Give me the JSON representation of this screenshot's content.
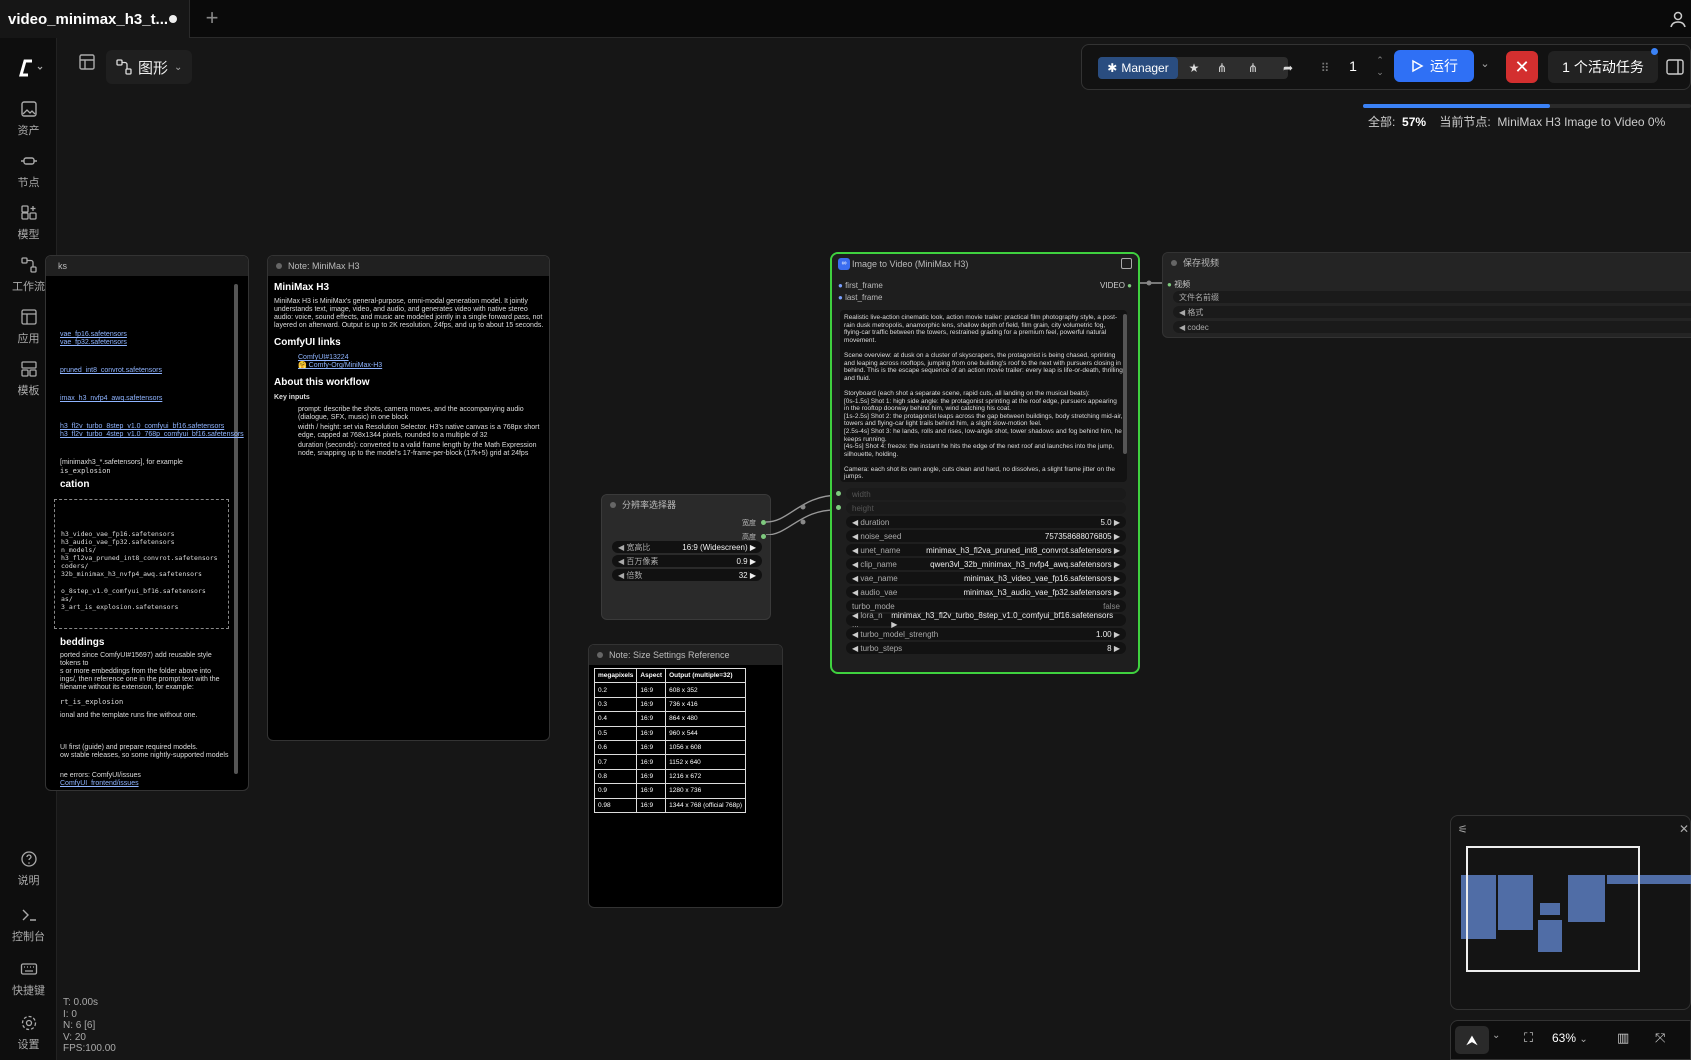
{
  "tab": {
    "title": "video_minimax_h3_t...",
    "plus": "+"
  },
  "toolbar": {
    "graph_label": "图形",
    "manager": "Manager",
    "queue_count": "1",
    "run_label": "运行",
    "cancel": "✕",
    "active_tasks": "1 个活动任务"
  },
  "progress": {
    "total_label": "全部:",
    "total_pct": "57%",
    "current_label": "当前节点:",
    "current_value": "MiniMax H3 Image to Video 0%",
    "fraction": 0.57
  },
  "sidebar": {
    "items": [
      {
        "label": "资产",
        "icon": "image-icon"
      },
      {
        "label": "节点",
        "icon": "node-icon"
      },
      {
        "label": "模型",
        "icon": "model-icon"
      },
      {
        "label": "工作流",
        "icon": "workflow-icon"
      },
      {
        "label": "应用",
        "icon": "app-icon"
      },
      {
        "label": "模板",
        "icon": "template-icon"
      }
    ],
    "bottom": [
      {
        "label": "说明",
        "icon": "help-icon"
      },
      {
        "label": "控制台",
        "icon": "terminal-icon"
      },
      {
        "label": "快捷键",
        "icon": "keyboard-icon"
      },
      {
        "label": "设置",
        "icon": "settings-icon"
      }
    ]
  },
  "left_note": {
    "title_fragment": "ks",
    "links": [
      "vae_fp16.safetensors",
      "vae_fp32.safetensors",
      "pruned_int8_convrot.safetensors",
      "imax_h3_nvfp4_awq.safetensors",
      "h3_fl2v_turbo_8step_v1.0_comfyui_bf16.safetensors",
      "h3_fl2v_turbo_4step_v1.0_768p_comfyui_bf16.safetensors"
    ],
    "example_note": "[minimaxh3_*.safetensors], for example",
    "example_value": "is_explosion",
    "heading_location": "cation",
    "files": [
      "h3_video_vae_fp16.safetensors",
      "h3_audio_vae_fp32.safetensors",
      "n_models/",
      "h3_fl2va_pruned_int8_convrot.safetensors",
      "coders/",
      "32b_minimax_h3_nvfp4_awq.safetensors",
      "o_8step_v1.0_comfyui_bf16.safetensors",
      "as/",
      "3_art_is_explosion.safetensors"
    ],
    "heading_embeddings": "beddings",
    "emb_text": [
      "ported since ComfyUI#15697) add reusable style tokens to",
      "s or more embeddings from the folder above into",
      "ings/, then reference one in the prompt text with the",
      "filename without its extension, for example:",
      "rt_is_explosion",
      "ional and the template runs fine without one."
    ],
    "footer": [
      "UI first (guide) and prepare required models.",
      "ow stable releases, so some nightly-supported models",
      "ne errors: ComfyUI/issues",
      "ComfyUI_frontend/issues"
    ]
  },
  "note_minimax": {
    "header": "Note: MiniMax H3",
    "title": "MiniMax H3",
    "intro": "MiniMax H3 is MiniMax's general-purpose, omni-modal generation model. It jointly understands text, image, video, and audio, and generates video with native stereo audio: voice, sound effects, and music are modeled jointly in a single forward pass, not layered on afterward. Output is up to 2K resolution, 24fps, and up to about 15 seconds.",
    "links_heading": "ComfyUI links",
    "links": [
      "ComfyUI#13224",
      "🤗 Comfy-Org/MiniMax-H3"
    ],
    "about_heading": "About this workflow",
    "key_inputs": "Key inputs",
    "bullets": [
      "prompt: describe the shots, camera moves, and the accompanying audio (dialogue, SFX, music) in one block",
      "width / height: set via Resolution Selector. H3's native canvas is a 768px short edge, capped at 768x1344 pixels, rounded to a multiple of 32",
      "duration (seconds): converted to a valid frame length by the Math Expression node, snapping up to the model's 17-frame-per-block (17k+5) grid at 24fps"
    ]
  },
  "resolution_node": {
    "header": "分辨率选择器",
    "out_width": "宽度",
    "out_height": "高度",
    "widgets": [
      {
        "name": "宽高比",
        "value": "16:9 (Widescreen)"
      },
      {
        "name": "百万像素",
        "value": "0.9"
      },
      {
        "name": "倍数",
        "value": "32"
      }
    ]
  },
  "size_ref": {
    "header": "Note: Size Settings Reference",
    "columns": [
      "megapixels",
      "Aspect",
      "Output (multiple=32)"
    ],
    "rows": [
      [
        "0.2",
        "16:9",
        "608 x 352"
      ],
      [
        "0.3",
        "16:9",
        "736 x 416"
      ],
      [
        "0.4",
        "16:9",
        "864 x 480"
      ],
      [
        "0.5",
        "16:9",
        "960 x 544"
      ],
      [
        "0.6",
        "16:9",
        "1056 x 608"
      ],
      [
        "0.7",
        "16:9",
        "1152 x 640"
      ],
      [
        "0.8",
        "16:9",
        "1216 x 672"
      ],
      [
        "0.9",
        "16:9",
        "1280 x 736"
      ],
      [
        "0.98",
        "16:9",
        "1344 x 768 (official 768p)"
      ]
    ]
  },
  "i2v_node": {
    "header": "Image to Video (MiniMax H3)",
    "inputs": [
      "first_frame",
      "last_frame"
    ],
    "output": "VIDEO",
    "prompt": [
      "Realistic live-action cinematic look, action movie trailer: practical film photography style, a post-rain dusk metropolis, anamorphic lens, shallow depth of field, film grain, city volumetric fog, flying-car traffic between the towers, restrained grading for a premium feel, powerful natural movement.",
      "Scene overview: at dusk on a cluster of skyscrapers, the protagonist is being chased, sprinting and leaping across rooftops, jumping from one building's roof to the next with pursuers closing in behind. This is the escape sequence of an action movie trailer: every leap is life-or-death, thrilling and fluid.",
      "Storyboard (each shot a separate scene, rapid cuts, all landing on the musical beats):\n[0s-1.5s] Shot 1: high side angle: the protagonist sprinting at the roof edge, pursuers appearing in the rooftop doorway behind him, wind catching his coat.\n[1s-2.5s] Shot 2: the protagonist leaps across the gap between buildings, body stretching mid-air, towers and flying-car light trails behind him, a slight slow-motion feel.\n[2.5s-4s] Shot 3: he lands, rolls and rises, low-angle shot, tower shadows and fog behind him, he keeps running.\n[4s-5s] Shot 4: freeze: the instant he hits the edge of the next roof and launches into the jump, silhouette, holding.",
      "Camera: each shot its own angle, cuts clean and hard, no dissolves, a slight frame jitter on the jumps."
    ],
    "disabled": [
      "width",
      "height"
    ],
    "widgets": [
      {
        "name": "duration",
        "value": "5.0"
      },
      {
        "name": "noise_seed",
        "value": "757358688076805"
      },
      {
        "name": "unet_name",
        "value": "minimax_h3_fl2va_pruned_int8_convrot.safetensors"
      },
      {
        "name": "clip_name",
        "value": "qwen3vl_32b_minimax_h3_nvfp4_awq.safetensors"
      },
      {
        "name": "vae_name",
        "value": "minimax_h3_video_vae_fp16.safetensors"
      },
      {
        "name": "audio_vae",
        "value": "minimax_h3_audio_vae_fp32.safetensors"
      },
      {
        "name": "turbo_mode",
        "value": "false"
      },
      {
        "name": "lora_n ...",
        "value": "minimax_h3_fl2v_turbo_8step_v1.0_comfyui_bf16.safetensors"
      },
      {
        "name": "turbo_model_strength",
        "value": "1.00"
      },
      {
        "name": "turbo_steps",
        "value": "8"
      }
    ]
  },
  "save_node": {
    "header": "保存视频",
    "input": "视频",
    "widgets": [
      "文件名前缀",
      "格式",
      "codec"
    ]
  },
  "stats": [
    "T: 0.00s",
    "I: 0",
    "N: 6 [6]",
    "V: 20",
    "FPS:100.00"
  ],
  "bottom": {
    "zoom": "63%"
  }
}
